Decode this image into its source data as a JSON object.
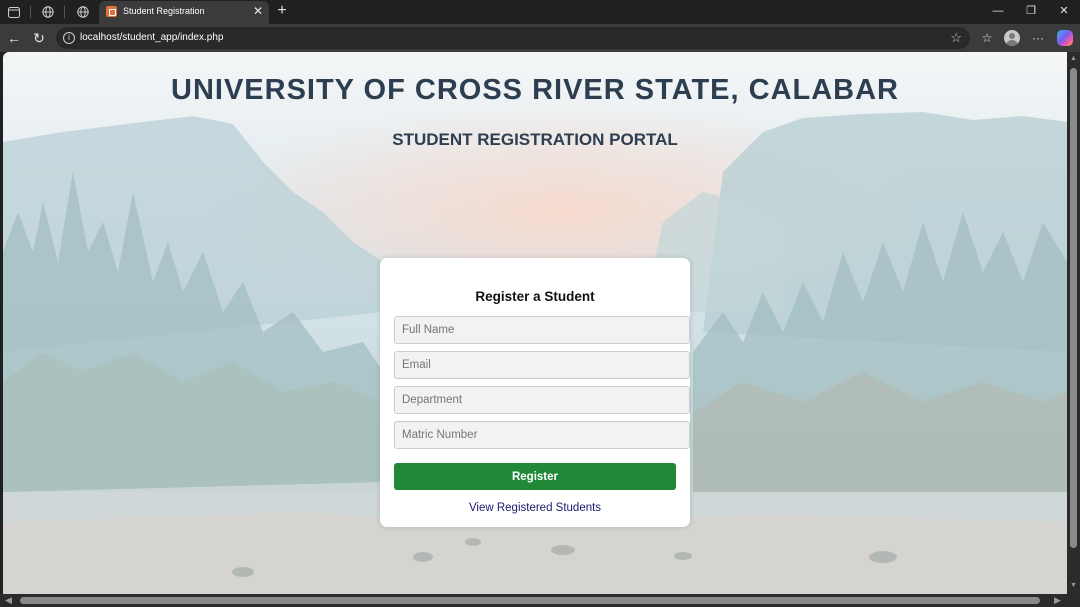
{
  "browser": {
    "tab_title": "Student Registration",
    "url": "localhost/student_app/index.php",
    "icons": {
      "sidebar": "sidebar-icon",
      "globe": "globe-icon",
      "favicon": "xampp-favicon",
      "close": "close-icon",
      "new_tab": "plus-icon",
      "back": "back-arrow-icon",
      "reload": "reload-icon",
      "info": "info-icon",
      "favorite": "star-icon",
      "favorites_list": "favorites-icon",
      "profile": "profile-icon",
      "more": "more-icon",
      "copilot": "copilot-icon"
    }
  },
  "page": {
    "university_title": "UNIVERSITY OF CROSS RIVER STATE, CALABAR",
    "portal_title": "STUDENT REGISTRATION PORTAL"
  },
  "form": {
    "title": "Register a Student",
    "fields": [
      {
        "placeholder": "Full Name",
        "value": ""
      },
      {
        "placeholder": "Email",
        "value": ""
      },
      {
        "placeholder": "Department",
        "value": ""
      },
      {
        "placeholder": "Matric Number",
        "value": ""
      }
    ],
    "submit_label": "Register",
    "view_link": "View Registered Students"
  },
  "colors": {
    "title": "#2d3e50",
    "button": "#218838",
    "link": "#1a1a6e"
  }
}
